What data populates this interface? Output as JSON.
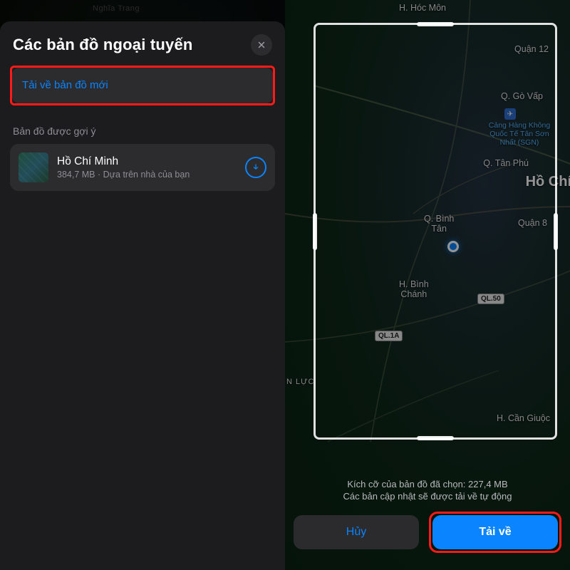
{
  "left": {
    "peek_location": "Nghĩa Trang",
    "sheet_title": "Các bản đồ ngoại tuyến",
    "download_new_label": "Tải về bản đồ mới",
    "suggested_section_label": "Bản đồ được gợi ý",
    "suggested": {
      "title": "Hồ Chí Minh",
      "size": "384,7 MB",
      "basis": "Dựa trên nhà của bạn"
    }
  },
  "right": {
    "map_labels": {
      "hoc_mon": "H. Hóc Môn",
      "quan12": "Quận 12",
      "go_vap": "Q. Gò Vấp",
      "airport": "Cảng Hàng Không\nQuốc Tế Tân Sơn\nNhất (SGN)",
      "tan_phu": "Q. Tân Phú",
      "city": "Hồ Chí",
      "binh_tan": "Q. Bình\nTân",
      "quan8": "Quận 8",
      "binh_chanh": "H. Bình\nChánh",
      "can_giuoc": "H. Cần Giuộc",
      "n_luc": "N LỰC",
      "ql50": "QL.50",
      "ql1a": "QL.1A"
    },
    "selected_size_line": "Kích cỡ của bản đồ đã chọn: 227,4 MB",
    "auto_update_line": "Các bản cập nhật sẽ được tải về tự động",
    "cancel_label": "Hủy",
    "download_label": "Tải về"
  }
}
